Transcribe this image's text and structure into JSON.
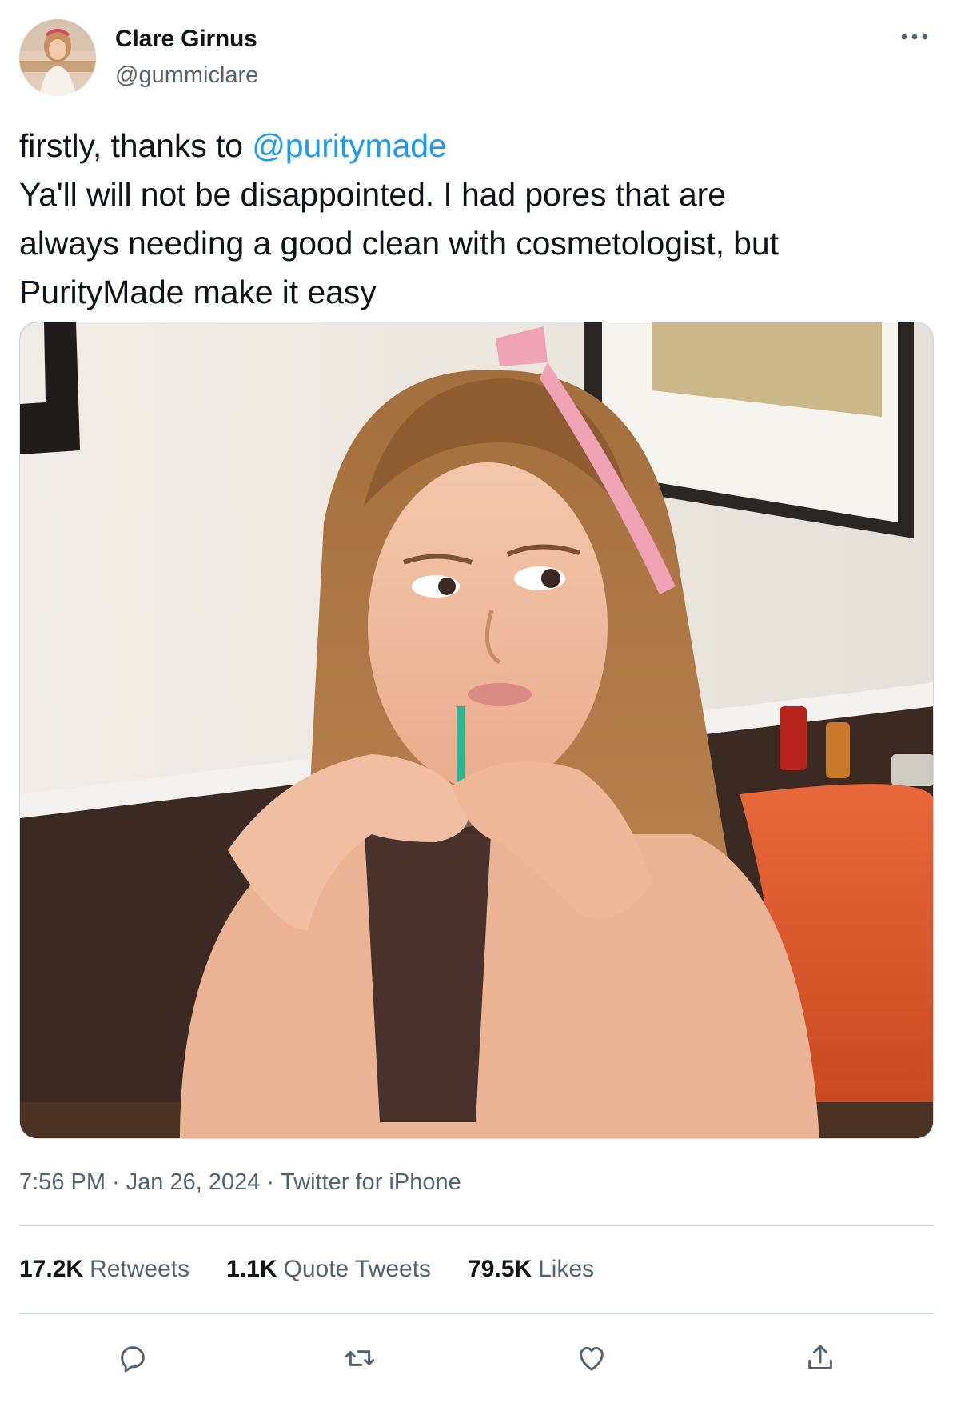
{
  "author": {
    "name": "Clare Girnus",
    "handle": "@gummiclare"
  },
  "tweet": {
    "line1_prefix": "firstly, thanks to ",
    "line1_mention": "@puritymade",
    "line2": "Ya'll will not be disappointed. I had pores that are",
    "line3": "always needing a good clean with cosmetologist, but",
    "line4": "PurityMade make it easy"
  },
  "meta": {
    "time": "7:56 PM",
    "date": "Jan 26, 2024",
    "source": "Twitter for iPhone",
    "separator": "·"
  },
  "stats": {
    "retweets_count": "17.2K",
    "retweets_label": "Retweets",
    "quotes_count": "1.1K",
    "quotes_label": "Quote Tweets",
    "likes_count": "79.5K",
    "likes_label": "Likes"
  },
  "icons": {
    "more": "more-dots-icon",
    "reply": "reply-icon",
    "retweet": "retweet-icon",
    "like": "heart-icon",
    "share": "share-icon"
  },
  "colors": {
    "text": "#0f1419",
    "secondary": "#536471",
    "link": "#1d9bf0",
    "border": "#cfd9de"
  }
}
